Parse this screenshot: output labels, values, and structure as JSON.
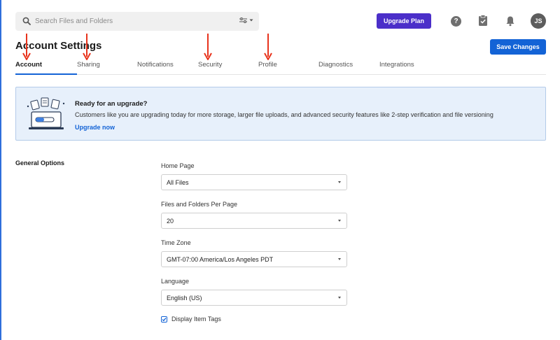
{
  "search": {
    "placeholder": "Search Files and Folders"
  },
  "header": {
    "upgrade_label": "Upgrade Plan",
    "help_glyph": "?",
    "avatar_initials": "JS"
  },
  "page": {
    "title": "Account Settings",
    "save_label": "Save Changes"
  },
  "tabs": [
    {
      "label": "Account",
      "active": true
    },
    {
      "label": "Sharing"
    },
    {
      "label": "Notifications"
    },
    {
      "label": "Security"
    },
    {
      "label": "Profile"
    },
    {
      "label": "Diagnostics"
    },
    {
      "label": "Integrations"
    }
  ],
  "banner": {
    "title": "Ready for an upgrade?",
    "text": "Customers like you are upgrading today for more storage, larger file uploads, and advanced security features like 2-step verification and file versioning",
    "link": "Upgrade now"
  },
  "general_options": {
    "title": "General Options",
    "home_page": {
      "label": "Home Page",
      "value": "All Files"
    },
    "per_page": {
      "label": "Files and Folders Per Page",
      "value": "20"
    },
    "time_zone": {
      "label": "Time Zone",
      "value": "GMT-07:00 America/Los Angeles PDT"
    },
    "language": {
      "label": "Language",
      "value": "English (US)"
    },
    "display_tags": {
      "label": "Display Item Tags",
      "checked": true
    }
  },
  "colors": {
    "accent": "#1363d6",
    "upgrade": "#4b2fc9",
    "annotation_arrow": "#e8331c",
    "banner_bg": "#e7f0fb"
  },
  "icons": [
    "search-icon",
    "filter-icon",
    "chevron-down-icon",
    "help-icon",
    "clipboard-check-icon",
    "bell-icon",
    "check-icon",
    "upgrade-illustration-icon"
  ]
}
